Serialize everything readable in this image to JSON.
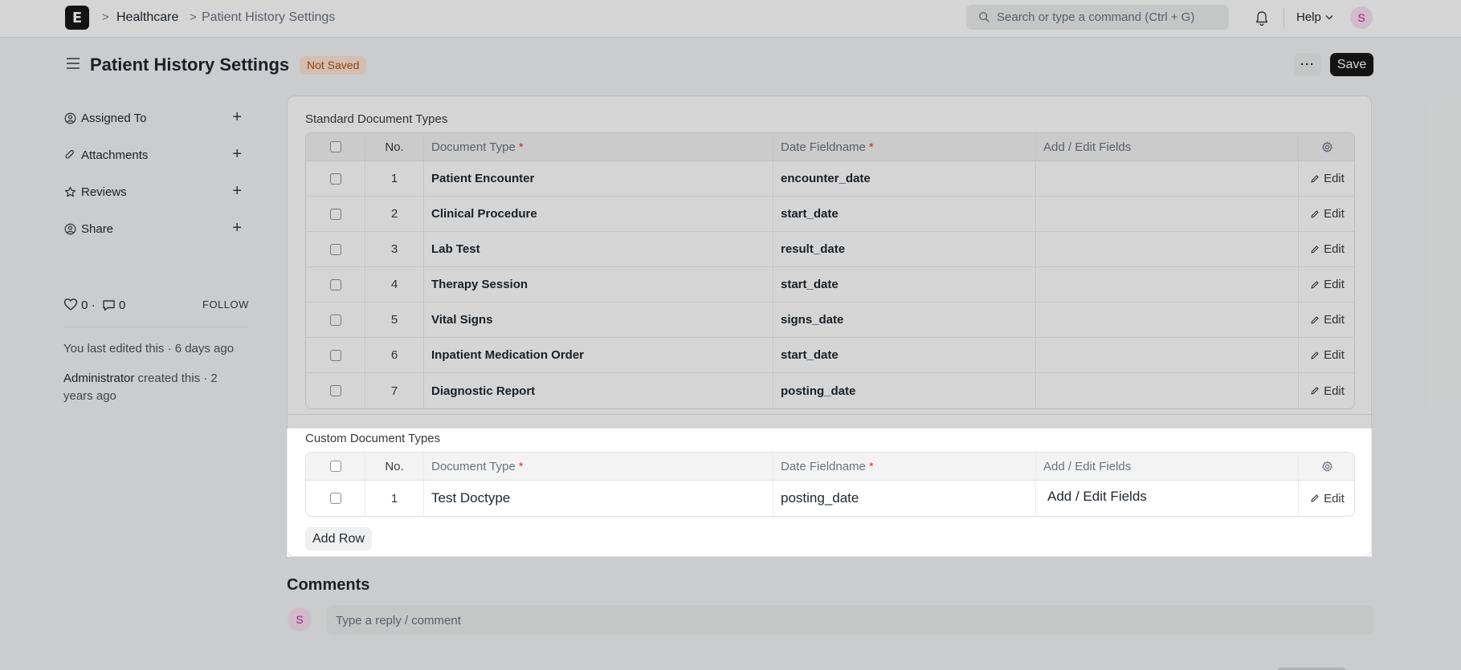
{
  "navbar": {
    "logo_letter": "E",
    "breadcrumbs": [
      "Healthcare",
      "Patient History Settings"
    ],
    "breadcrumb_sep": ">",
    "search_placeholder": "Search or type a command (Ctrl + G)",
    "help_label": "Help",
    "avatar_initial": "S"
  },
  "page": {
    "title": "Patient History Settings",
    "status_badge": "Not Saved",
    "more_label": "···",
    "save_label": "Save"
  },
  "sidebar": {
    "items": [
      {
        "label": "Assigned To",
        "icon": "assign-icon"
      },
      {
        "label": "Attachments",
        "icon": "paperclip-icon"
      },
      {
        "label": "Reviews",
        "icon": "star-icon"
      },
      {
        "label": "Share",
        "icon": "share-icon"
      }
    ],
    "likes_count": "0",
    "comments_count": "0",
    "dot": "·",
    "follow_label": "FOLLOW",
    "last_edited": "You last edited this · 6 days ago",
    "created_by": "Administrator",
    "created_text": " created this · 2 years ago"
  },
  "standard": {
    "section_label": "Standard Document Types",
    "headers": {
      "no": "No.",
      "doc_type": "Document Type",
      "date_field": "Date Fieldname",
      "add_edit": "Add / Edit Fields",
      "required_mark": "*"
    },
    "rows": [
      {
        "no": "1",
        "doc_type": "Patient Encounter",
        "date_field": "encounter_date",
        "edit": "Edit"
      },
      {
        "no": "2",
        "doc_type": "Clinical Procedure",
        "date_field": "start_date",
        "edit": "Edit"
      },
      {
        "no": "3",
        "doc_type": "Lab Test",
        "date_field": "result_date",
        "edit": "Edit"
      },
      {
        "no": "4",
        "doc_type": "Therapy Session",
        "date_field": "start_date",
        "edit": "Edit"
      },
      {
        "no": "5",
        "doc_type": "Vital Signs",
        "date_field": "signs_date",
        "edit": "Edit"
      },
      {
        "no": "6",
        "doc_type": "Inpatient Medication Order",
        "date_field": "start_date",
        "edit": "Edit"
      },
      {
        "no": "7",
        "doc_type": "Diagnostic Report",
        "date_field": "posting_date",
        "edit": "Edit"
      }
    ]
  },
  "custom": {
    "section_label": "Custom Document Types",
    "headers": {
      "no": "No.",
      "doc_type": "Document Type",
      "date_field": "Date Fieldname",
      "add_edit": "Add / Edit Fields",
      "required_mark": "*"
    },
    "rows": [
      {
        "no": "1",
        "doc_type": "Test Doctype",
        "date_field": "posting_date",
        "add_edit": "Add / Edit Fields",
        "edit": "Edit"
      }
    ],
    "add_row_label": "Add Row"
  },
  "comments": {
    "title": "Comments",
    "avatar_initial": "S",
    "placeholder": "Type a reply / comment"
  },
  "colors": {
    "save_bg": "#171717",
    "badge_bg": "#fde4d4",
    "badge_text": "#b34e14",
    "avatar_bg": "#fbe0f0",
    "avatar_text": "#c026a5",
    "required": "#e03636"
  }
}
